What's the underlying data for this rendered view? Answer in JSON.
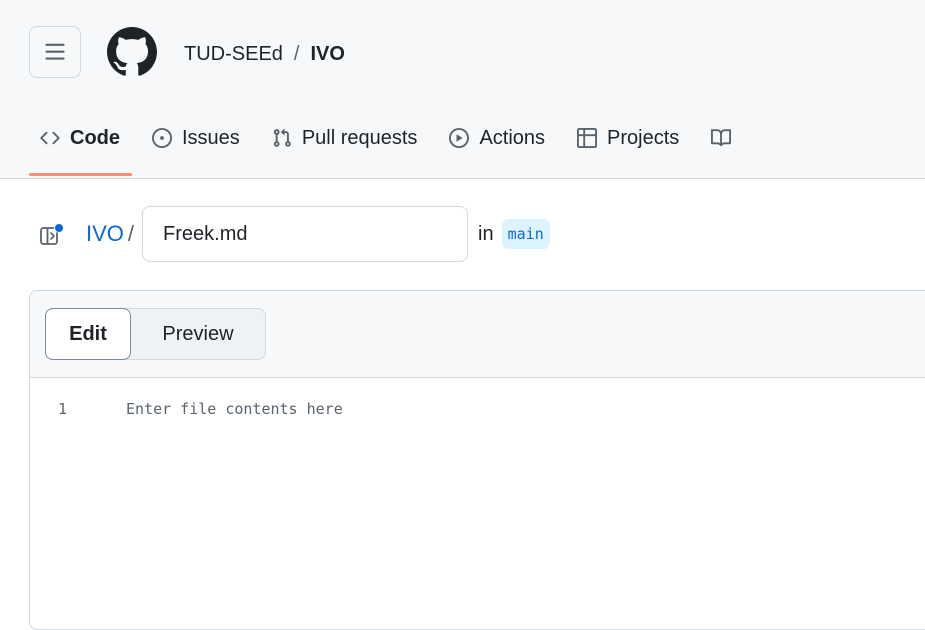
{
  "header": {
    "owner": "TUD-SEEd",
    "separator": "/",
    "repo": "IVO"
  },
  "tabs": [
    {
      "label": "Code",
      "icon": "code-icon",
      "selected": true
    },
    {
      "label": "Issues",
      "icon": "issue-opened-icon",
      "selected": false
    },
    {
      "label": "Pull requests",
      "icon": "git-pull-request-icon",
      "selected": false
    },
    {
      "label": "Actions",
      "icon": "play-icon",
      "selected": false
    },
    {
      "label": "Projects",
      "icon": "table-icon",
      "selected": false
    },
    {
      "label": "",
      "icon": "book-icon",
      "selected": false
    }
  ],
  "filebar": {
    "repo_link": "IVO",
    "slash": "/",
    "filename": "Freek.md",
    "in_label": "in",
    "branch": "main"
  },
  "editor": {
    "edit_label": "Edit",
    "preview_label": "Preview",
    "line_number": "1",
    "placeholder": "Enter file contents here"
  },
  "colors": {
    "accent_link": "#0969da",
    "tab_underline": "#fd8c73",
    "branch_bg": "#ddf4ff",
    "panel_dot": "#0969da"
  }
}
